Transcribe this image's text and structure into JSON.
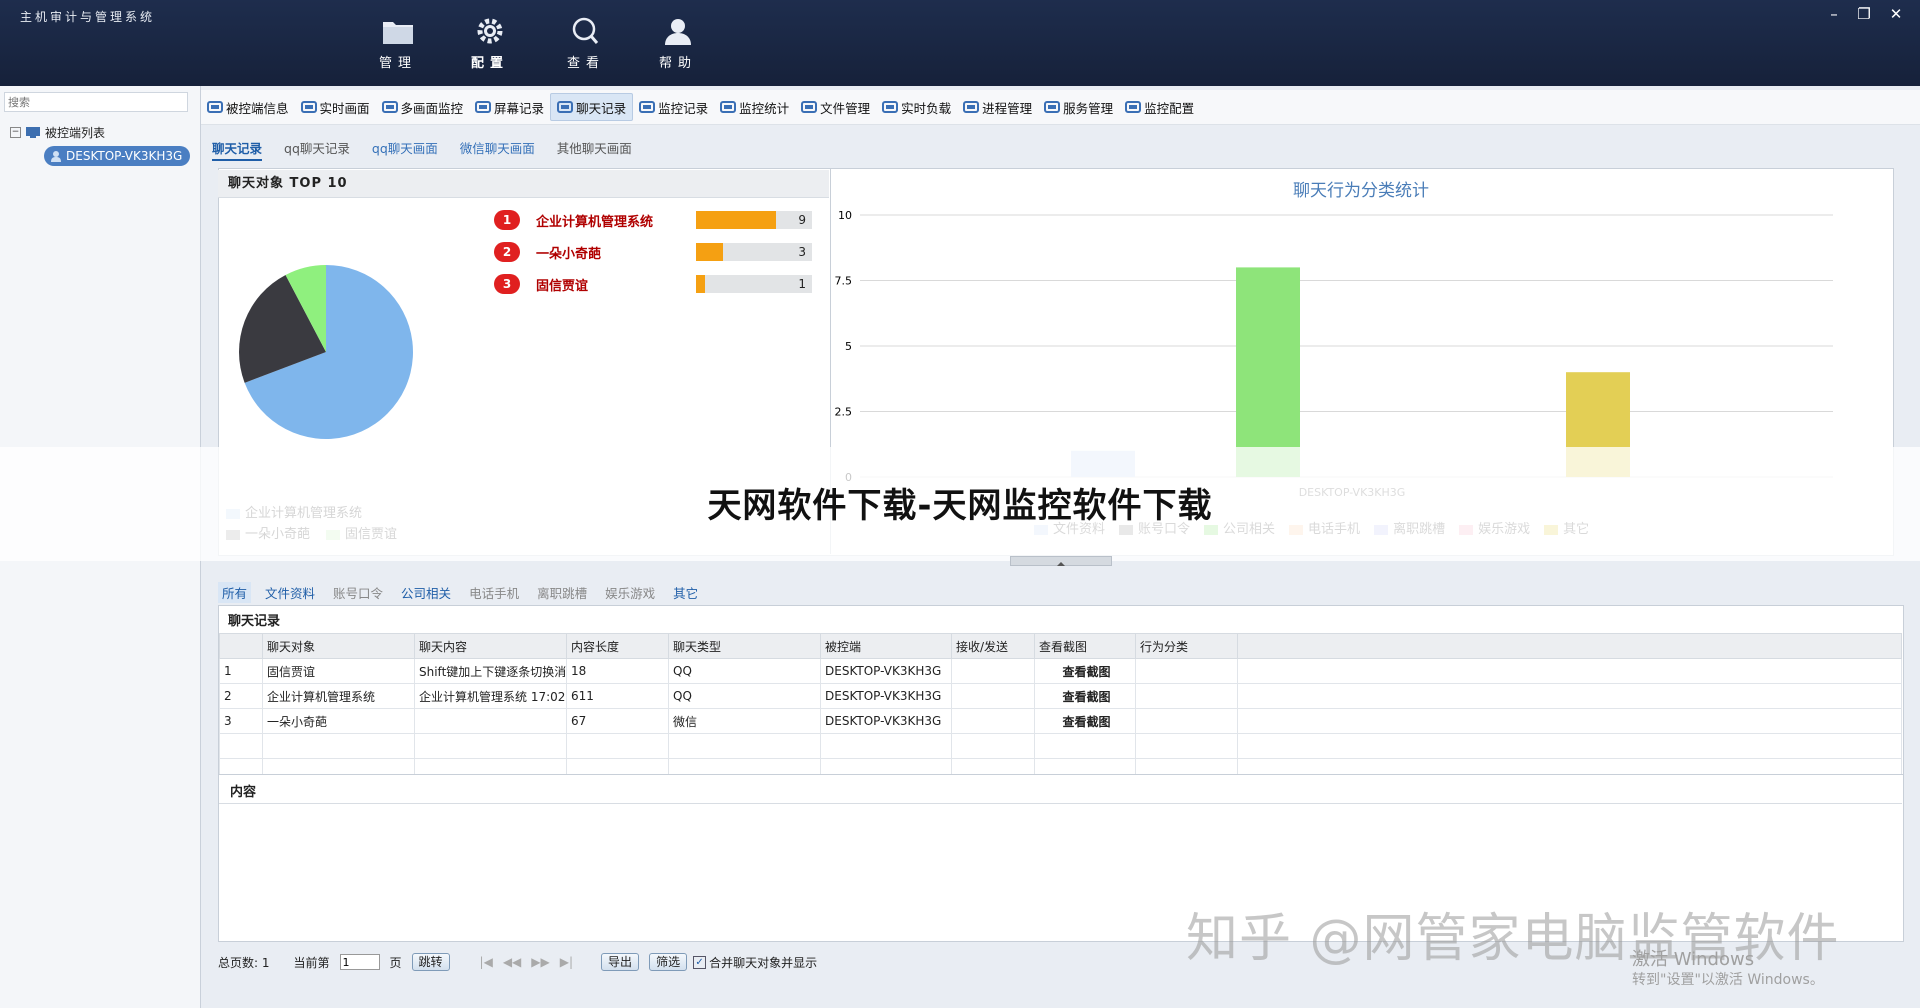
{
  "app": {
    "title": "主机审计与管理系统"
  },
  "window_controls": {
    "minimize": "–",
    "restore": "❐",
    "close": "✕"
  },
  "top_nav": [
    {
      "label": "管理",
      "icon": "folder-icon"
    },
    {
      "label": "配置",
      "icon": "gear-icon"
    },
    {
      "label": "查看",
      "icon": "search-icon"
    },
    {
      "label": "帮助",
      "icon": "user-icon"
    }
  ],
  "sidebar": {
    "search_placeholder": "搜索",
    "tree_root": "被控端列表",
    "tree_toggle": "−",
    "node": "DESKTOP-VK3KH3G"
  },
  "toolbar": [
    {
      "label": "被控端信息",
      "icon": "users-icon"
    },
    {
      "label": "实时画面",
      "icon": "monitor-icon"
    },
    {
      "label": "多画面监控",
      "icon": "multi-monitor-icon"
    },
    {
      "label": "屏幕记录",
      "icon": "screen-record-icon"
    },
    {
      "label": "聊天记录",
      "icon": "chat-icon",
      "active": true
    },
    {
      "label": "监控记录",
      "icon": "monitor-log-icon"
    },
    {
      "label": "监控统计",
      "icon": "stats-icon"
    },
    {
      "label": "文件管理",
      "icon": "tools-icon"
    },
    {
      "label": "实时负载",
      "icon": "load-icon"
    },
    {
      "label": "进程管理",
      "icon": "process-icon"
    },
    {
      "label": "服务管理",
      "icon": "service-icon"
    },
    {
      "label": "监控配置",
      "icon": "config-icon"
    }
  ],
  "subtabs": [
    "聊天记录",
    "qq聊天记录",
    "qq聊天画面",
    "微信聊天画面",
    "其他聊天画面"
  ],
  "top10": {
    "title": "聊天对象  TOP 10",
    "items": [
      {
        "rank": "1",
        "name": "企业计算机管理系统",
        "count": 9
      },
      {
        "rank": "2",
        "name": "一朵小奇葩",
        "count": 3
      },
      {
        "rank": "3",
        "name": "固信贾谊",
        "count": 1
      }
    ],
    "max": 9
  },
  "chart_data": [
    {
      "type": "pie",
      "labels": [
        "企业计算机管理系统",
        "一朵小奇葩",
        "固信贾谊"
      ],
      "values": [
        9,
        3,
        1
      ],
      "colors": [
        "#7fb6ec",
        "#3a3a40",
        "#8ff07e"
      ],
      "legend_colors": [
        "#c9def3",
        "#a7a7aa",
        "#c9f2c1"
      ]
    },
    {
      "type": "bar",
      "title": "聊天行为分类统计",
      "categories": [
        "DESKTOP-VK3KH3G"
      ],
      "ylim": [
        0,
        10
      ],
      "yticks": [
        "0",
        "2.5",
        "5",
        "7.5",
        "10"
      ],
      "series": [
        {
          "name": "文件资料",
          "values": [
            1
          ],
          "color": "#c6daf3"
        },
        {
          "name": "账号口令",
          "values": [
            0
          ],
          "color": "#9a9a9a"
        },
        {
          "name": "公司相关",
          "values": [
            8
          ],
          "color": "#8ee47a"
        },
        {
          "name": "电话手机",
          "values": [
            0
          ],
          "color": "#f8d3ad"
        },
        {
          "name": "离职跳槽",
          "values": [
            0
          ],
          "color": "#c4c8f4"
        },
        {
          "name": "娱乐游戏",
          "values": [
            0
          ],
          "color": "#f4b8c8"
        },
        {
          "name": "其它",
          "values": [
            4
          ],
          "color": "#e3cf55"
        }
      ]
    }
  ],
  "watermark_band": "天网软件下载-天网监控软件下载",
  "filter_tabs": [
    "所有",
    "文件资料",
    "账号口令",
    "公司相关",
    "电话手机",
    "离职跳槽",
    "娱乐游戏",
    "其它"
  ],
  "records": {
    "title": "聊天记录",
    "columns": [
      "",
      "聊天对象",
      "聊天内容",
      "内容长度",
      "聊天类型",
      "被控端",
      "接收/发送",
      "查看截图",
      "行为分类",
      ""
    ],
    "rows": [
      [
        "1",
        "固信贾谊",
        "Shift键加上下键逐条切换消",
        "18",
        "QQ",
        "DESKTOP-VK3KH3G",
        "",
        "查看截图",
        ""
      ],
      [
        "2",
        "企业计算机管理系统",
        "企业计算机管理系统  17:02",
        "611",
        "QQ",
        "DESKTOP-VK3KH3G",
        "",
        "查看截图",
        ""
      ],
      [
        "3",
        "一朵小奇葩",
        "",
        "67",
        "微信",
        "DESKTOP-VK3KH3G",
        "",
        "查看截图",
        ""
      ]
    ]
  },
  "content": {
    "title": "内容"
  },
  "pager": {
    "total": "总页数: 1",
    "current_prefix": "当前第",
    "page_value": "1",
    "page_suffix": "页",
    "jump": "跳转",
    "first": "|◀",
    "prev": "◀◀",
    "next": "▶▶",
    "last": "▶|",
    "export": "导出",
    "filter": "筛选",
    "merge_label": "合并聊天对象并显示",
    "merge_checked": "✓"
  },
  "overlay": {
    "zhihu": "知乎 @网管家电脑监管软件",
    "activate_1": "激活 Windows",
    "activate_2": "转到\"设置\"以激活 Windows。"
  }
}
